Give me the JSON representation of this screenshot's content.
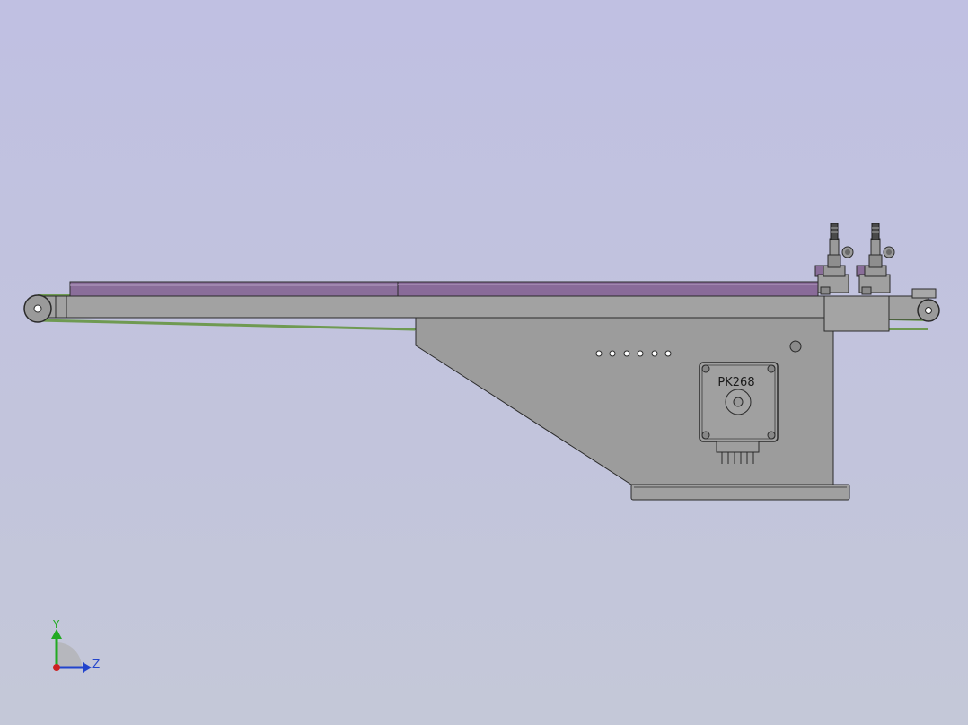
{
  "viewport": {
    "background_top": "#c0c0e2",
    "background_bottom": "#c4c8d8"
  },
  "model": {
    "motor_label": "PK268",
    "colors": {
      "frame": "#9c9c9c",
      "frame_edge": "#2a2a2a",
      "belt": "#6f9a52",
      "plate": "#8a6e9a",
      "motor": "#a0a0a0"
    }
  },
  "triad": {
    "y_label": "Y",
    "z_label": "Z",
    "y_color": "#22aa22",
    "z_color": "#2244cc",
    "x_color": "#cc2222"
  }
}
